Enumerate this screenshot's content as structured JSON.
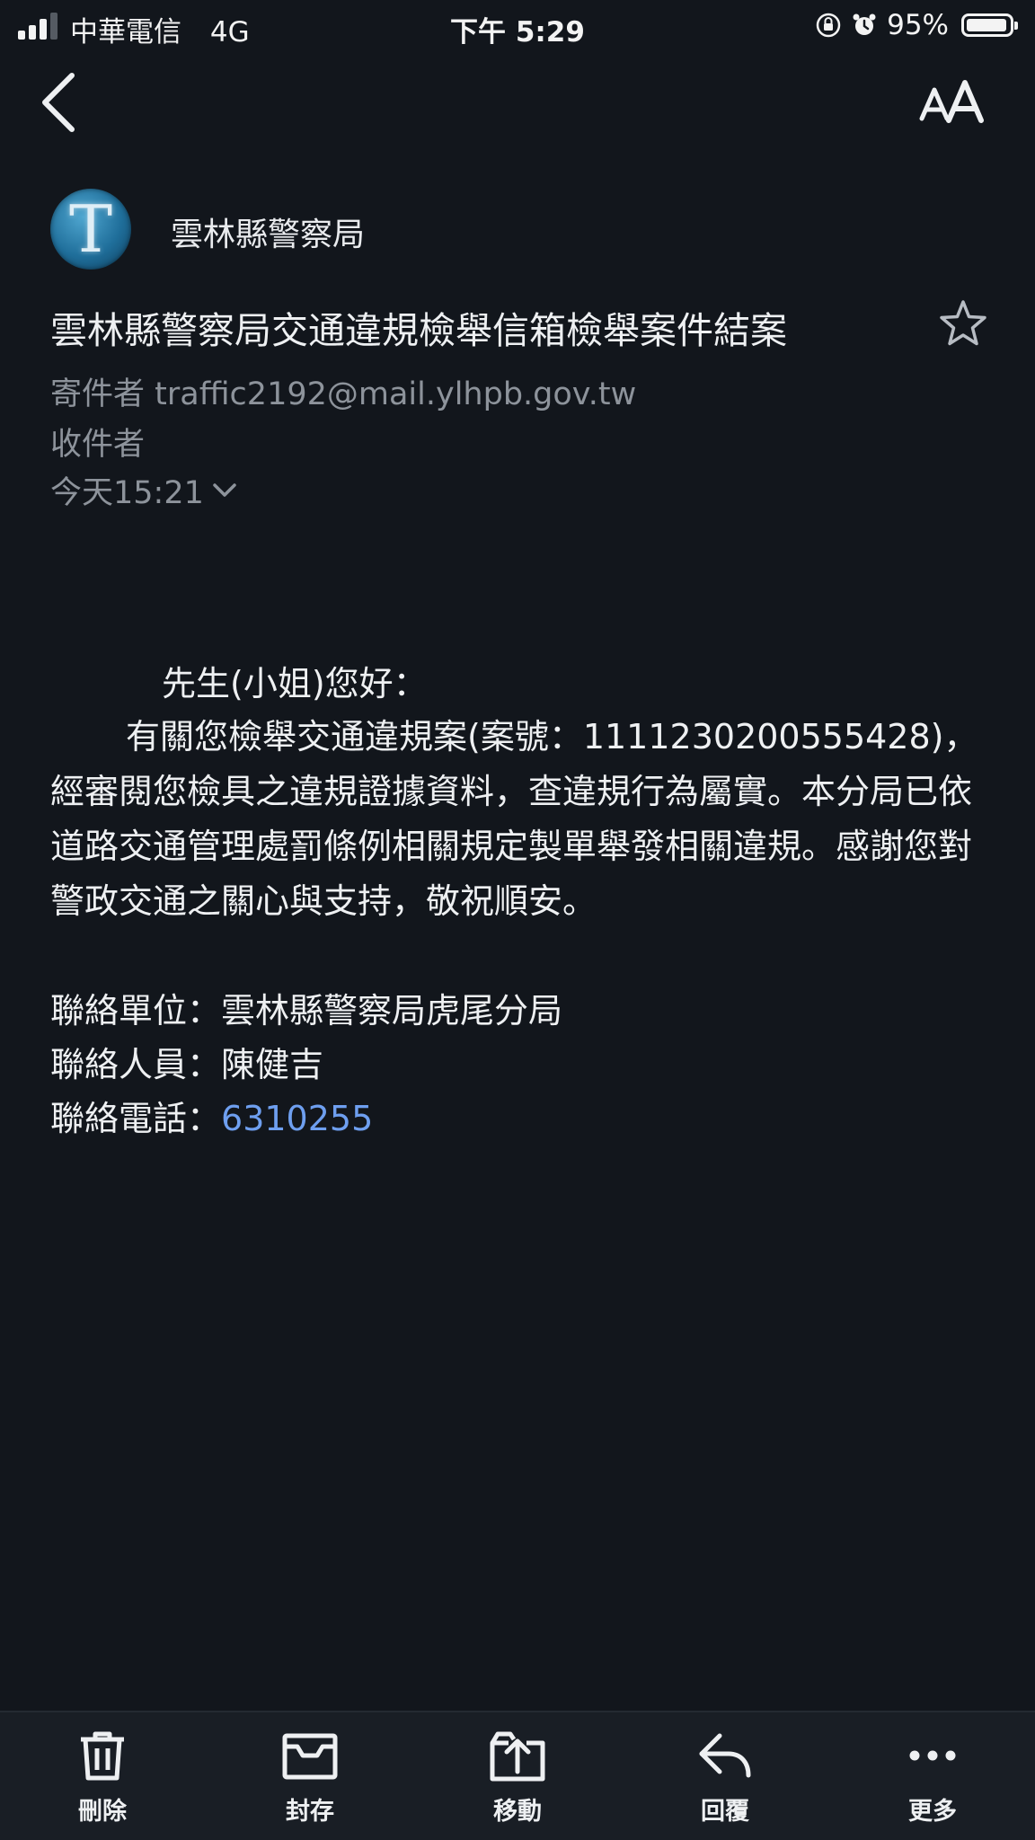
{
  "status_bar": {
    "carrier": "中華電信",
    "network": "4G",
    "time": "下午 5:29",
    "battery_percent_text": "95%",
    "battery_level": 0.95
  },
  "email": {
    "sender_avatar_letter": "T",
    "sender_name": "雲林縣警察局",
    "subject": "雲林縣警察局交通違規檢舉信箱檢舉案件結案",
    "from_label": "寄件者",
    "from_address": "traffic2192@mail.ylhpb.gov.tw",
    "to_label": "收件者",
    "date": "今天15:21",
    "body": {
      "greeting": "先生(小姐)您好：",
      "paragraph": "有關您檢舉交通違規案(案號：1111230200555428)，經審閱您檢具之違規證據資料，查違規行為屬實。本分局已依道路交通管理處罰條例相關規定製單舉發相關違規。感謝您對警政交通之關心與支持，敬祝順安。",
      "contact_unit": "聯絡單位：雲林縣警察局虎尾分局",
      "contact_person": "聯絡人員：陳健吉",
      "contact_phone_label": "聯絡電話：",
      "contact_phone": "6310255"
    }
  },
  "toolbar": {
    "delete_label": "刪除",
    "archive_label": "封存",
    "move_label": "移動",
    "reply_label": "回覆",
    "more_label": "更多"
  },
  "colors": {
    "background": "#12161c",
    "link": "#6e9ff0",
    "secondary_text": "#8d939b"
  },
  "icons": {
    "back": "chevron-left-icon",
    "text_size": "text-size-icon",
    "star": "star-icon",
    "date_expand": "chevron-down-icon",
    "delete": "trash-icon",
    "archive": "archive-box-icon",
    "move": "folder-move-icon",
    "reply": "reply-icon",
    "more": "more-dots-icon"
  }
}
